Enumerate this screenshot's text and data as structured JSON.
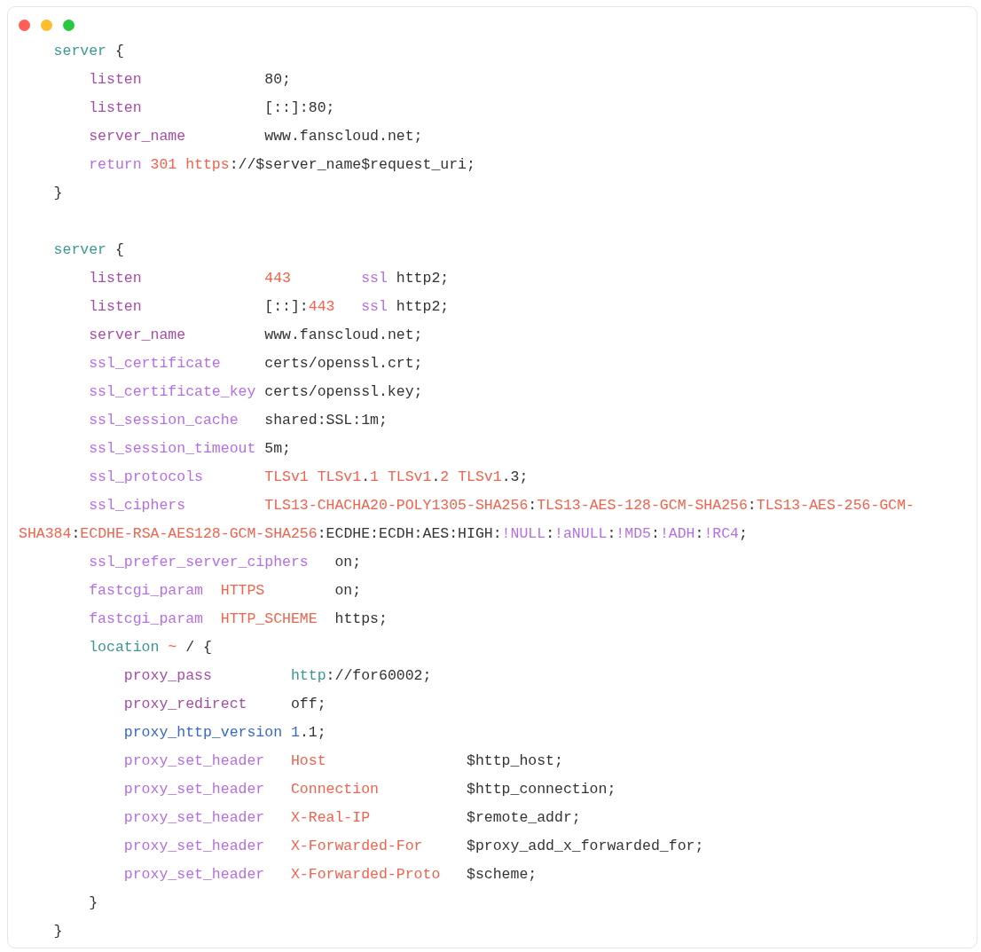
{
  "window": {
    "controls": [
      {
        "color": "#ff5f57"
      },
      {
        "color": "#febc2e"
      },
      {
        "color": "#28c840"
      }
    ]
  },
  "code_lines": [
    {
      "kind": "code",
      "tokens": [
        {
          "kind": "section",
          "text": "    server"
        },
        {
          "kind": "plain",
          "text": " {"
        }
      ]
    },
    {
      "kind": "code",
      "tokens": [
        {
          "kind": "directive",
          "text": "        listen"
        },
        {
          "kind": "plain",
          "text": "              80;"
        }
      ]
    },
    {
      "kind": "code",
      "tokens": [
        {
          "kind": "directive",
          "text": "        listen"
        },
        {
          "kind": "plain",
          "text": "              [::]:80;"
        }
      ]
    },
    {
      "kind": "code",
      "tokens": [
        {
          "kind": "directive",
          "text": "        server_name"
        },
        {
          "kind": "plain",
          "text": "         www.fanscloud.net;"
        }
      ]
    },
    {
      "kind": "code",
      "tokens": [
        {
          "kind": "keyword",
          "text": "        return"
        },
        {
          "kind": "literal",
          "text": " 301"
        },
        {
          "kind": "literal",
          "text": " https"
        },
        {
          "kind": "plain",
          "text": "://$server_name$request_uri;"
        }
      ]
    },
    {
      "kind": "code",
      "tokens": [
        {
          "kind": "plain",
          "text": "    }"
        }
      ]
    },
    {
      "kind": "blank"
    },
    {
      "kind": "code",
      "tokens": [
        {
          "kind": "section",
          "text": "    server"
        },
        {
          "kind": "plain",
          "text": " {"
        }
      ]
    },
    {
      "kind": "code",
      "tokens": [
        {
          "kind": "directive",
          "text": "        listen"
        },
        {
          "kind": "literal",
          "text": "              443"
        },
        {
          "kind": "keyword",
          "text": "        ssl"
        },
        {
          "kind": "plain",
          "text": " http2;"
        }
      ]
    },
    {
      "kind": "code",
      "tokens": [
        {
          "kind": "directive",
          "text": "        listen"
        },
        {
          "kind": "plain",
          "text": "              [::]:"
        },
        {
          "kind": "literal",
          "text": "443"
        },
        {
          "kind": "keyword",
          "text": "   ssl"
        },
        {
          "kind": "plain",
          "text": " http2;"
        }
      ]
    },
    {
      "kind": "code",
      "tokens": [
        {
          "kind": "directive",
          "text": "        server_name"
        },
        {
          "kind": "plain",
          "text": "         www.fanscloud.net;"
        }
      ]
    },
    {
      "kind": "code",
      "tokens": [
        {
          "kind": "keyword",
          "text": "        ssl_certificate"
        },
        {
          "kind": "plain",
          "text": "     certs/openssl.crt;"
        }
      ]
    },
    {
      "kind": "code",
      "tokens": [
        {
          "kind": "keyword",
          "text": "        ssl_certificate_key"
        },
        {
          "kind": "plain",
          "text": " certs/openssl.key;"
        }
      ]
    },
    {
      "kind": "code",
      "tokens": [
        {
          "kind": "keyword",
          "text": "        ssl_session_cache"
        },
        {
          "kind": "plain",
          "text": "   shared:SSL:1m;"
        }
      ]
    },
    {
      "kind": "code",
      "tokens": [
        {
          "kind": "keyword",
          "text": "        ssl_session_timeout"
        },
        {
          "kind": "plain",
          "text": " 5m;"
        }
      ]
    },
    {
      "kind": "code",
      "tokens": [
        {
          "kind": "keyword",
          "text": "        ssl_protocols"
        },
        {
          "kind": "literal",
          "text": "       TLSv1"
        },
        {
          "kind": "literal",
          "text": " TLSv1"
        },
        {
          "kind": "plain",
          "text": "."
        },
        {
          "kind": "literal",
          "text": "1"
        },
        {
          "kind": "literal",
          "text": " TLSv1"
        },
        {
          "kind": "plain",
          "text": "."
        },
        {
          "kind": "literal",
          "text": "2"
        },
        {
          "kind": "literal",
          "text": " TLSv1"
        },
        {
          "kind": "plain",
          "text": ".3;"
        }
      ]
    },
    {
      "kind": "code",
      "tokens": [
        {
          "kind": "keyword",
          "text": "        ssl_ciphers"
        },
        {
          "kind": "literal",
          "text": "         TLS13-CHACHA20-POLY1305-SHA256"
        },
        {
          "kind": "plain",
          "text": ":"
        },
        {
          "kind": "literal",
          "text": "TLS13-AES-128-GCM-SHA256"
        },
        {
          "kind": "plain",
          "text": ":"
        },
        {
          "kind": "literal",
          "text": "TLS13-AES-256-GCM-"
        }
      ]
    },
    {
      "kind": "code",
      "tokens": [
        {
          "kind": "literal",
          "text": "SHA384"
        },
        {
          "kind": "plain",
          "text": ":"
        },
        {
          "kind": "literal",
          "text": "ECDHE-RSA-AES128-GCM-SHA256"
        },
        {
          "kind": "plain",
          "text": ":ECDHE:ECDH:AES:HIGH:"
        },
        {
          "kind": "keyword",
          "text": "!NULL"
        },
        {
          "kind": "plain",
          "text": ":"
        },
        {
          "kind": "keyword",
          "text": "!aNULL"
        },
        {
          "kind": "plain",
          "text": ":"
        },
        {
          "kind": "keyword",
          "text": "!MD5"
        },
        {
          "kind": "plain",
          "text": ":"
        },
        {
          "kind": "keyword",
          "text": "!ADH"
        },
        {
          "kind": "plain",
          "text": ":"
        },
        {
          "kind": "keyword",
          "text": "!RC4"
        },
        {
          "kind": "plain",
          "text": ";"
        }
      ]
    },
    {
      "kind": "code",
      "tokens": [
        {
          "kind": "keyword",
          "text": "        ssl_prefer_server_ciphers"
        },
        {
          "kind": "plain",
          "text": "   on;"
        }
      ]
    },
    {
      "kind": "code",
      "tokens": [
        {
          "kind": "keyword",
          "text": "        fastcgi_param"
        },
        {
          "kind": "literal",
          "text": "  HTTPS"
        },
        {
          "kind": "plain",
          "text": "        on;"
        }
      ]
    },
    {
      "kind": "code",
      "tokens": [
        {
          "kind": "keyword",
          "text": "        fastcgi_param"
        },
        {
          "kind": "literal",
          "text": "  HTTP_SCHEME"
        },
        {
          "kind": "plain",
          "text": "  https;"
        }
      ]
    },
    {
      "kind": "code",
      "tokens": [
        {
          "kind": "section",
          "text": "        location"
        },
        {
          "kind": "literal",
          "text": " ~"
        },
        {
          "kind": "plain",
          "text": " / {"
        }
      ]
    },
    {
      "kind": "code",
      "tokens": [
        {
          "kind": "directive",
          "text": "            proxy_pass"
        },
        {
          "kind": "section",
          "text": "         http"
        },
        {
          "kind": "plain",
          "text": "://for60002;"
        }
      ]
    },
    {
      "kind": "code",
      "tokens": [
        {
          "kind": "directive",
          "text": "            proxy_redirect"
        },
        {
          "kind": "plain",
          "text": "     off;"
        }
      ]
    },
    {
      "kind": "code",
      "tokens": [
        {
          "kind": "builtin",
          "text": "            proxy_http_version"
        },
        {
          "kind": "builtin",
          "text": " 1"
        },
        {
          "kind": "plain",
          "text": ".1;"
        }
      ]
    },
    {
      "kind": "code",
      "tokens": [
        {
          "kind": "keyword",
          "text": "            proxy_set_header"
        },
        {
          "kind": "literal",
          "text": "   Host"
        },
        {
          "kind": "plain",
          "text": "                $http_host;"
        }
      ]
    },
    {
      "kind": "code",
      "tokens": [
        {
          "kind": "keyword",
          "text": "            proxy_set_header"
        },
        {
          "kind": "literal",
          "text": "   Connection"
        },
        {
          "kind": "plain",
          "text": "          $http_connection;"
        }
      ]
    },
    {
      "kind": "code",
      "tokens": [
        {
          "kind": "keyword",
          "text": "            proxy_set_header"
        },
        {
          "kind": "literal",
          "text": "   X-Real-IP"
        },
        {
          "kind": "plain",
          "text": "           $remote_addr;"
        }
      ]
    },
    {
      "kind": "code",
      "tokens": [
        {
          "kind": "keyword",
          "text": "            proxy_set_header"
        },
        {
          "kind": "literal",
          "text": "   X-Forwarded-For"
        },
        {
          "kind": "plain",
          "text": "     $proxy_add_x_forwarded_for;"
        }
      ]
    },
    {
      "kind": "code",
      "tokens": [
        {
          "kind": "keyword",
          "text": "            proxy_set_header"
        },
        {
          "kind": "literal",
          "text": "   X-Forwarded-Proto"
        },
        {
          "kind": "plain",
          "text": "   $scheme;"
        }
      ]
    },
    {
      "kind": "code",
      "tokens": [
        {
          "kind": "plain",
          "text": "        }"
        }
      ]
    },
    {
      "kind": "code",
      "tokens": [
        {
          "kind": "plain",
          "text": "    }"
        }
      ]
    }
  ]
}
